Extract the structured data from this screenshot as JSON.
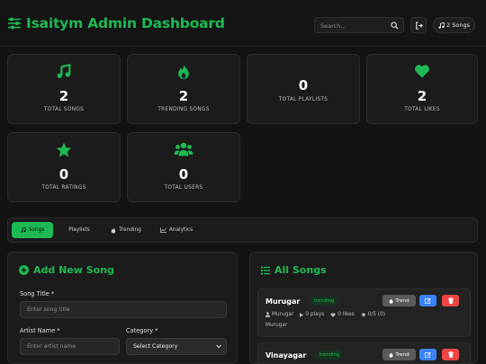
{
  "header": {
    "title": "Isaitym Admin Dashboard",
    "search_placeholder": "Search...",
    "songs_count_label": "2 Songs"
  },
  "stats": [
    {
      "icon": "music-note-icon",
      "value": "2",
      "label": "TOTAL SONGS"
    },
    {
      "icon": "fire-icon",
      "value": "2",
      "label": "TRENDING SONGS"
    },
    {
      "icon": "",
      "value": "0",
      "label": "TOTAL PLAYLISTS"
    },
    {
      "icon": "heart-icon",
      "value": "2",
      "label": "TOTAL LIKES"
    },
    {
      "icon": "star-icon",
      "value": "0",
      "label": "TOTAL RATINGS"
    },
    {
      "icon": "users-icon",
      "value": "0",
      "label": "TOTAL USERS"
    }
  ],
  "tabs": [
    {
      "label": "Songs",
      "icon": "music-note-icon",
      "active": true
    },
    {
      "label": "Playlists",
      "icon": "",
      "active": false
    },
    {
      "label": "Trending",
      "icon": "fire-icon",
      "active": false
    },
    {
      "label": "Analytics",
      "icon": "chart-icon",
      "active": false
    }
  ],
  "add_song": {
    "title": "Add New Song",
    "song_title_label": "Song Title *",
    "song_title_placeholder": "Enter song title",
    "artist_label": "Artist Name *",
    "artist_placeholder": "Enter artist name",
    "category_label": "Category *",
    "category_value": "Select Category"
  },
  "all_songs": {
    "title": "All Songs",
    "trend_label": "Trend",
    "songs": [
      {
        "title": "Murugar",
        "badge": "trending",
        "artist": "Murugar",
        "plays": "0 plays",
        "likes": "0 likes",
        "rating": "0/5 (0)",
        "artist_line": "Murugar"
      },
      {
        "title": "Vinayagar",
        "badge": "trending"
      }
    ]
  },
  "colors": {
    "accent": "#1db954",
    "background": "#121212",
    "card": "#1b1b1b",
    "edit": "#3b82f6",
    "delete": "#ef4444"
  }
}
